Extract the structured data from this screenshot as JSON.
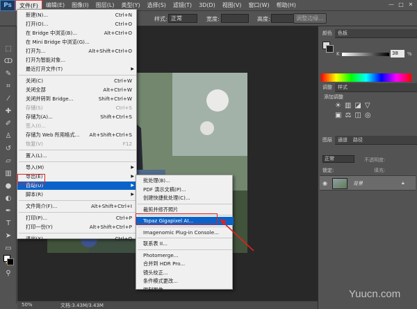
{
  "menubar": {
    "logo": "Ps",
    "items": [
      "文件(F)",
      "编辑(E)",
      "图像(I)",
      "图层(L)",
      "类型(Y)",
      "选择(S)",
      "滤镜(T)",
      "3D(D)",
      "视图(V)",
      "窗口(W)",
      "帮助(H)"
    ],
    "window_buttons": [
      "—",
      "□",
      "✕"
    ]
  },
  "options_bar": {
    "style_label": "样式:",
    "style_value": "正常",
    "width_label": "宽度:",
    "height_label": "高度:",
    "refine_button": "调整边缘..."
  },
  "file_menu": {
    "items": [
      {
        "label": "新建(N)...",
        "shortcut": "Ctrl+N"
      },
      {
        "label": "打开(O)...",
        "shortcut": "Ctrl+O"
      },
      {
        "label": "在 Bridge 中浏览(B)...",
        "shortcut": "Alt+Ctrl+O"
      },
      {
        "label": "在 Mini Bridge 中浏览(G)...",
        "shortcut": ""
      },
      {
        "label": "打开为...",
        "shortcut": "Alt+Shift+Ctrl+O"
      },
      {
        "label": "打开为智能对象...",
        "shortcut": ""
      },
      {
        "label": "最近打开文件(T)",
        "shortcut": "",
        "submenu": true
      },
      {
        "label": "关闭(C)",
        "shortcut": "Ctrl+W"
      },
      {
        "label": "关闭全部",
        "shortcut": "Alt+Ctrl+W"
      },
      {
        "label": "关闭并转到 Bridge...",
        "shortcut": "Shift+Ctrl+W"
      },
      {
        "label": "存储(S)",
        "shortcut": "Ctrl+S",
        "disabled": true
      },
      {
        "label": "存储为(A)...",
        "shortcut": "Shift+Ctrl+S"
      },
      {
        "label": "签入(I)...",
        "shortcut": "",
        "disabled": true
      },
      {
        "label": "存储为 Web 所用格式...",
        "shortcut": "Alt+Shift+Ctrl+S"
      },
      {
        "label": "恢复(V)",
        "shortcut": "F12",
        "disabled": true
      },
      {
        "label": "置入(L)...",
        "shortcut": ""
      },
      {
        "label": "导入(M)",
        "shortcut": "",
        "submenu": true
      },
      {
        "label": "导出(E)",
        "shortcut": "",
        "submenu": true
      },
      {
        "label": "自动(U)",
        "shortcut": "",
        "submenu": true,
        "highlighted": true
      },
      {
        "label": "脚本(R)",
        "shortcut": "",
        "submenu": true
      },
      {
        "label": "文件简介(F)...",
        "shortcut": "Alt+Shift+Ctrl+I"
      },
      {
        "label": "打印(P)...",
        "shortcut": "Ctrl+P"
      },
      {
        "label": "打印一份(Y)",
        "shortcut": "Alt+Shift+Ctrl+P"
      },
      {
        "label": "退出(X)",
        "shortcut": "Ctrl+Q"
      }
    ]
  },
  "automate_submenu": {
    "items": [
      "批处理(B)...",
      "PDF 演示文稿(P)...",
      "创建快捷批处理(C)...",
      "裁剪并修齐照片",
      "Topaz Gigapixel AI...",
      "Imagenomic Plug-in Console...",
      "联系表 II...",
      "Photomerge...",
      "合并到 HDR Pro...",
      "镜头校正...",
      "条件模式更改...",
      "限制图像..."
    ],
    "highlighted_index": 4
  },
  "color_panel": {
    "tabs": [
      "颜色",
      "色板"
    ],
    "channel_label": "K",
    "value": "38",
    "unit": "%"
  },
  "adjustments_panel": {
    "tabs": [
      "调整",
      "样式"
    ],
    "title": "添加调整"
  },
  "layers_panel": {
    "tabs": [
      "图层",
      "通道",
      "路径"
    ],
    "blend_mode": "正常",
    "opacity_label": "不透明度:",
    "lock_label": "锁定:",
    "fill_label": "填充:",
    "layer_name": "背景"
  },
  "status_bar": {
    "zoom": "50%",
    "doc_info": "文档:3.43M/3.43M"
  },
  "watermark": "Yuucn.com"
}
